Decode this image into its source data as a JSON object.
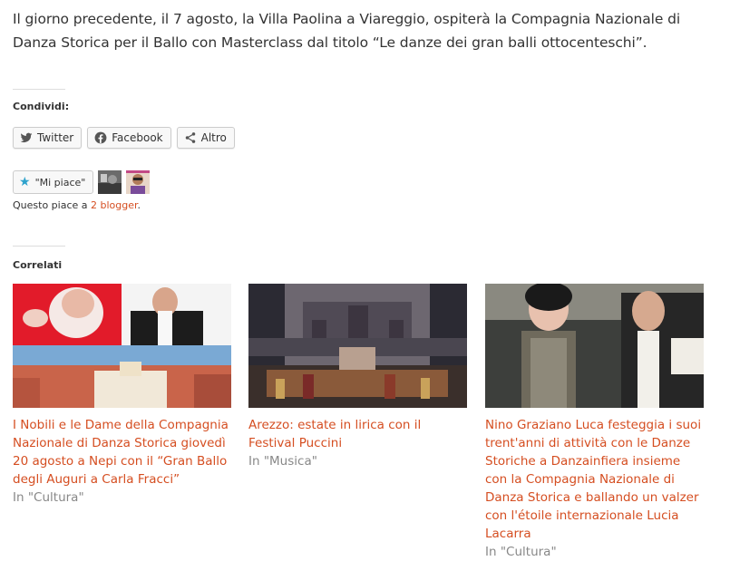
{
  "article": {
    "paragraph": "Il giorno precedente, il 7 agosto, la Villa Paolina a Viareggio, ospiterà la Compagnia Nazionale di Danza Storica per il Ballo con Masterclass dal titolo “Le danze dei gran balli ottocenteschi”."
  },
  "share": {
    "title": "Condividi:",
    "buttons": [
      {
        "label": "Twitter",
        "icon": "twitter-icon"
      },
      {
        "label": "Facebook",
        "icon": "facebook-icon"
      },
      {
        "label": "Altro",
        "icon": "share-icon"
      }
    ]
  },
  "like": {
    "button_label": "\"Mi piace\"",
    "text_prefix": "Questo piace a ",
    "link_text": "2 blogger",
    "text_suffix": "."
  },
  "related": {
    "title": "Correlati",
    "posts": [
      {
        "title": "I Nobili e le Dame della Compagnia Nazionale di Danza Storica giovedì 20 agosto a Nepi con il “Gran Ballo degli Auguri a Carla Fracci”",
        "category": "In \"Cultura\""
      },
      {
        "title": "Arezzo: estate in lirica con il Festival Puccini",
        "category": "In \"Musica\""
      },
      {
        "title": "Nino Graziano Luca festeggia i suoi trent'anni di attività con le Danze Storiche a Danzainfiera insieme con la Compagnia Nazionale di Danza Storica e ballando un valzer con l'étoile internazionale Lucia Lacarra",
        "category": "In \"Cultura\""
      }
    ]
  },
  "colors": {
    "link": "#d54e21",
    "star": "#2ea2cc"
  }
}
